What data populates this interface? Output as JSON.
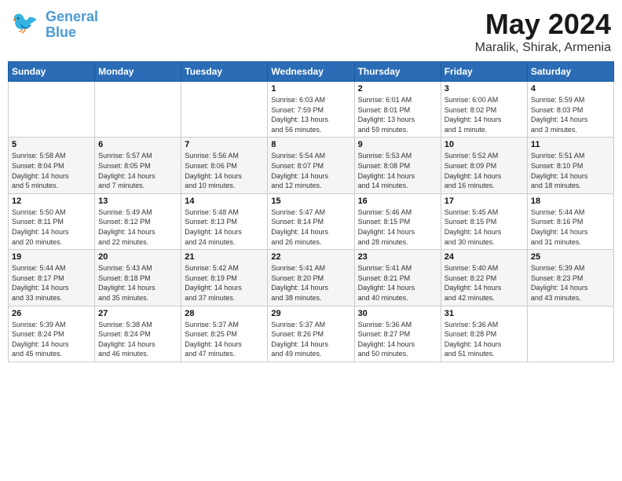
{
  "header": {
    "logo_line1": "General",
    "logo_line2": "Blue",
    "month": "May 2024",
    "location": "Maralik, Shirak, Armenia"
  },
  "weekdays": [
    "Sunday",
    "Monday",
    "Tuesday",
    "Wednesday",
    "Thursday",
    "Friday",
    "Saturday"
  ],
  "weeks": [
    [
      {
        "day": "",
        "info": ""
      },
      {
        "day": "",
        "info": ""
      },
      {
        "day": "",
        "info": ""
      },
      {
        "day": "1",
        "info": "Sunrise: 6:03 AM\nSunset: 7:59 PM\nDaylight: 13 hours\nand 56 minutes."
      },
      {
        "day": "2",
        "info": "Sunrise: 6:01 AM\nSunset: 8:01 PM\nDaylight: 13 hours\nand 59 minutes."
      },
      {
        "day": "3",
        "info": "Sunrise: 6:00 AM\nSunset: 8:02 PM\nDaylight: 14 hours\nand 1 minute."
      },
      {
        "day": "4",
        "info": "Sunrise: 5:59 AM\nSunset: 8:03 PM\nDaylight: 14 hours\nand 3 minutes."
      }
    ],
    [
      {
        "day": "5",
        "info": "Sunrise: 5:58 AM\nSunset: 8:04 PM\nDaylight: 14 hours\nand 5 minutes."
      },
      {
        "day": "6",
        "info": "Sunrise: 5:57 AM\nSunset: 8:05 PM\nDaylight: 14 hours\nand 7 minutes."
      },
      {
        "day": "7",
        "info": "Sunrise: 5:56 AM\nSunset: 8:06 PM\nDaylight: 14 hours\nand 10 minutes."
      },
      {
        "day": "8",
        "info": "Sunrise: 5:54 AM\nSunset: 8:07 PM\nDaylight: 14 hours\nand 12 minutes."
      },
      {
        "day": "9",
        "info": "Sunrise: 5:53 AM\nSunset: 8:08 PM\nDaylight: 14 hours\nand 14 minutes."
      },
      {
        "day": "10",
        "info": "Sunrise: 5:52 AM\nSunset: 8:09 PM\nDaylight: 14 hours\nand 16 minutes."
      },
      {
        "day": "11",
        "info": "Sunrise: 5:51 AM\nSunset: 8:10 PM\nDaylight: 14 hours\nand 18 minutes."
      }
    ],
    [
      {
        "day": "12",
        "info": "Sunrise: 5:50 AM\nSunset: 8:11 PM\nDaylight: 14 hours\nand 20 minutes."
      },
      {
        "day": "13",
        "info": "Sunrise: 5:49 AM\nSunset: 8:12 PM\nDaylight: 14 hours\nand 22 minutes."
      },
      {
        "day": "14",
        "info": "Sunrise: 5:48 AM\nSunset: 8:13 PM\nDaylight: 14 hours\nand 24 minutes."
      },
      {
        "day": "15",
        "info": "Sunrise: 5:47 AM\nSunset: 8:14 PM\nDaylight: 14 hours\nand 26 minutes."
      },
      {
        "day": "16",
        "info": "Sunrise: 5:46 AM\nSunset: 8:15 PM\nDaylight: 14 hours\nand 28 minutes."
      },
      {
        "day": "17",
        "info": "Sunrise: 5:45 AM\nSunset: 8:15 PM\nDaylight: 14 hours\nand 30 minutes."
      },
      {
        "day": "18",
        "info": "Sunrise: 5:44 AM\nSunset: 8:16 PM\nDaylight: 14 hours\nand 31 minutes."
      }
    ],
    [
      {
        "day": "19",
        "info": "Sunrise: 5:44 AM\nSunset: 8:17 PM\nDaylight: 14 hours\nand 33 minutes."
      },
      {
        "day": "20",
        "info": "Sunrise: 5:43 AM\nSunset: 8:18 PM\nDaylight: 14 hours\nand 35 minutes."
      },
      {
        "day": "21",
        "info": "Sunrise: 5:42 AM\nSunset: 8:19 PM\nDaylight: 14 hours\nand 37 minutes."
      },
      {
        "day": "22",
        "info": "Sunrise: 5:41 AM\nSunset: 8:20 PM\nDaylight: 14 hours\nand 38 minutes."
      },
      {
        "day": "23",
        "info": "Sunrise: 5:41 AM\nSunset: 8:21 PM\nDaylight: 14 hours\nand 40 minutes."
      },
      {
        "day": "24",
        "info": "Sunrise: 5:40 AM\nSunset: 8:22 PM\nDaylight: 14 hours\nand 42 minutes."
      },
      {
        "day": "25",
        "info": "Sunrise: 5:39 AM\nSunset: 8:23 PM\nDaylight: 14 hours\nand 43 minutes."
      }
    ],
    [
      {
        "day": "26",
        "info": "Sunrise: 5:39 AM\nSunset: 8:24 PM\nDaylight: 14 hours\nand 45 minutes."
      },
      {
        "day": "27",
        "info": "Sunrise: 5:38 AM\nSunset: 8:24 PM\nDaylight: 14 hours\nand 46 minutes."
      },
      {
        "day": "28",
        "info": "Sunrise: 5:37 AM\nSunset: 8:25 PM\nDaylight: 14 hours\nand 47 minutes."
      },
      {
        "day": "29",
        "info": "Sunrise: 5:37 AM\nSunset: 8:26 PM\nDaylight: 14 hours\nand 49 minutes."
      },
      {
        "day": "30",
        "info": "Sunrise: 5:36 AM\nSunset: 8:27 PM\nDaylight: 14 hours\nand 50 minutes."
      },
      {
        "day": "31",
        "info": "Sunrise: 5:36 AM\nSunset: 8:28 PM\nDaylight: 14 hours\nand 51 minutes."
      },
      {
        "day": "",
        "info": ""
      }
    ]
  ]
}
